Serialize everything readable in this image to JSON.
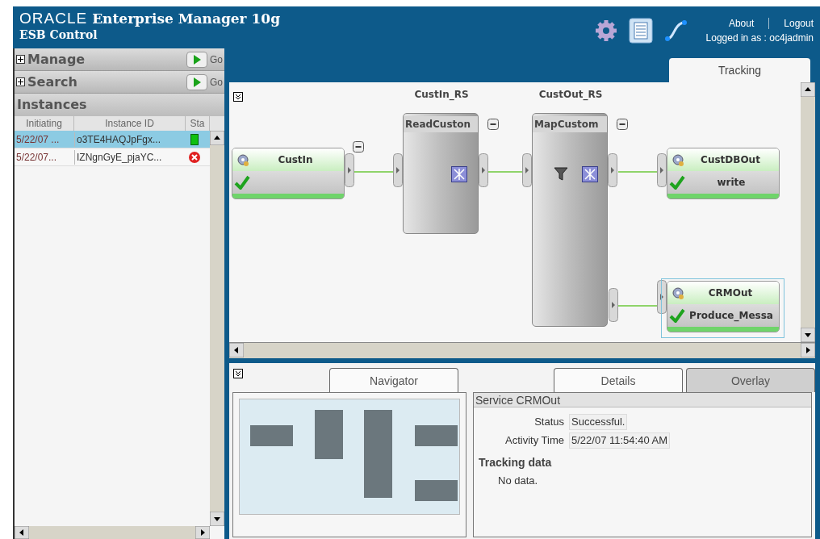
{
  "header": {
    "logo": "ORACLE",
    "title": "Enterprise Manager 10g",
    "subtitle": "ESB Control",
    "links": [
      "About",
      "Logout"
    ],
    "login": "Logged in as : oc4jadmin"
  },
  "sidebar": {
    "sections": [
      {
        "label": "Manage",
        "go": "Go",
        "expanded": false
      },
      {
        "label": "Search",
        "go": "Go",
        "expanded": false
      }
    ],
    "instances": {
      "title": "Instances",
      "columns": [
        "Initiating",
        "Instance ID",
        "Sta"
      ],
      "rows": [
        {
          "initiating": "5/22/07 ...",
          "instance_id": "o3TE4HAQJpFgx...",
          "kind": "success",
          "selected": true
        },
        {
          "initiating": "5/22/07...",
          "instance_id": "IZNgnGyE_pjaYC...",
          "kind": "error",
          "selected": false
        }
      ]
    }
  },
  "tabs": [
    {
      "label": "Tracking",
      "selected": true
    }
  ],
  "diagram": {
    "routing_services": [
      {
        "label": "CustIn_RS",
        "name": "ReadCuston"
      },
      {
        "label": "CustOut_RS",
        "name": "MapCustom"
      }
    ],
    "services": [
      {
        "name": "CustIn",
        "succeeded": true,
        "selected": false
      },
      {
        "name": "CustDBOut",
        "operation": "write",
        "succeeded": true,
        "selected": false
      },
      {
        "name": "CRMOut",
        "operation": "Produce_Messa",
        "succeeded": true,
        "selected": true
      }
    ]
  },
  "bottom": {
    "left_tabs": [
      {
        "label": "Navigator",
        "selected": true
      }
    ],
    "right_tabs": [
      {
        "label": "Details",
        "selected": true
      },
      {
        "label": "Overlay",
        "selected": false
      }
    ],
    "details": {
      "title": "Service CRMOut",
      "fields": [
        {
          "label": "Status",
          "value": "Successful."
        },
        {
          "label": "Activity Time",
          "value": "5/22/07 11:54:40 AM"
        }
      ],
      "tracking_heading": "Tracking data",
      "tracking_text": "No data."
    }
  }
}
